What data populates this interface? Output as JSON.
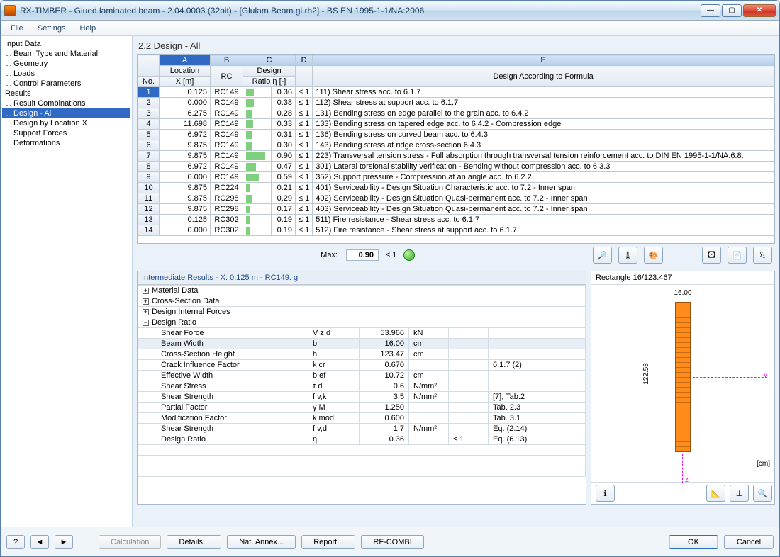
{
  "window": {
    "title": "RX-TIMBER - Glued laminated beam - 2.04.0003 (32bit) - [Glulam Beam.gl.rh2] - BS EN 1995-1-1/NA:2006"
  },
  "menu": {
    "file": "File",
    "settings": "Settings",
    "help": "Help"
  },
  "tree": {
    "input": "Input Data",
    "beamtype": "Beam Type and Material",
    "geometry": "Geometry",
    "loads": "Loads",
    "control": "Control Parameters",
    "results": "Results",
    "rescomb": "Result Combinations",
    "designall": "Design - All",
    "designloc": "Design by Location X",
    "support": "Support Forces",
    "deform": "Deformations"
  },
  "main": {
    "title": "2.2 Design - All",
    "colA": "A",
    "colB": "B",
    "colC": "C",
    "colD": "D",
    "colE": "E",
    "hNo": "No.",
    "hLoc": "Location",
    "hX": "X [m]",
    "hRC": "RC",
    "hDesign": "Design",
    "hRatio": "Ratio η [-]",
    "hFormula": "Design According to Formula",
    "rows": [
      {
        "no": "1",
        "x": "0.125",
        "rc": "RC149",
        "bar": 36,
        "ratio": "0.36",
        "le": "≤ 1",
        "formula": "111) Shear stress acc. to 6.1.7"
      },
      {
        "no": "2",
        "x": "0.000",
        "rc": "RC149",
        "bar": 38,
        "ratio": "0.38",
        "le": "≤ 1",
        "formula": "112) Shear stress at support acc. to 6.1.7"
      },
      {
        "no": "3",
        "x": "6.275",
        "rc": "RC149",
        "bar": 28,
        "ratio": "0.28",
        "le": "≤ 1",
        "formula": "131) Bending stress on edge parallel to the grain acc. to 6.4.2"
      },
      {
        "no": "4",
        "x": "11.698",
        "rc": "RC149",
        "bar": 33,
        "ratio": "0.33",
        "le": "≤ 1",
        "formula": "133) Bending stress on tapered edge acc. to 6.4.2 - Compression edge"
      },
      {
        "no": "5",
        "x": "6.972",
        "rc": "RC149",
        "bar": 31,
        "ratio": "0.31",
        "le": "≤ 1",
        "formula": "136) Bending stress on curved beam acc. to 6.4.3"
      },
      {
        "no": "6",
        "x": "9.875",
        "rc": "RC149",
        "bar": 30,
        "ratio": "0.30",
        "le": "≤ 1",
        "formula": "143) Bending stress at ridge cross-section 6.4.3"
      },
      {
        "no": "7",
        "x": "9.875",
        "rc": "RC149",
        "bar": 90,
        "ratio": "0.90",
        "le": "≤ 1",
        "formula": "223) Transversal tension stress - Full absorption through transversal tension reinforcement acc. to DIN EN 1995-1-1/NA.6.8."
      },
      {
        "no": "8",
        "x": "6.972",
        "rc": "RC149",
        "bar": 47,
        "ratio": "0.47",
        "le": "≤ 1",
        "formula": "301) Lateral torsional stability verification - Bending without compression acc. to 6.3.3"
      },
      {
        "no": "9",
        "x": "0.000",
        "rc": "RC149",
        "bar": 59,
        "ratio": "0.59",
        "le": "≤ 1",
        "formula": "352) Support pressure - Compression at an angle acc. to 6.2.2"
      },
      {
        "no": "10",
        "x": "9.875",
        "rc": "RC224",
        "bar": 21,
        "ratio": "0.21",
        "le": "≤ 1",
        "formula": "401) Serviceability - Design Situation Characteristic acc. to 7.2 - Inner span"
      },
      {
        "no": "11",
        "x": "9.875",
        "rc": "RC298",
        "bar": 29,
        "ratio": "0.29",
        "le": "≤ 1",
        "formula": "402) Serviceability - Design Situation Quasi-permanent acc. to 7.2 - Inner span"
      },
      {
        "no": "12",
        "x": "9.875",
        "rc": "RC298",
        "bar": 17,
        "ratio": "0.17",
        "le": "≤ 1",
        "formula": "403) Serviceability - Design Situation Quasi-permanent acc. to 7.2 - Inner span"
      },
      {
        "no": "13",
        "x": "0.125",
        "rc": "RC302",
        "bar": 19,
        "ratio": "0.19",
        "le": "≤ 1",
        "formula": "511) Fire resistance - Shear stress acc. to 6.1.7"
      },
      {
        "no": "14",
        "x": "0.000",
        "rc": "RC302",
        "bar": 19,
        "ratio": "0.19",
        "le": "≤ 1",
        "formula": "512) Fire resistance - Shear stress at support acc. to 6.1.7"
      }
    ],
    "maxlbl": "Max:",
    "maxval": "0.90",
    "maxle": "≤ 1"
  },
  "inter": {
    "title": "Intermediate Results  -  X: 0.125 m  -  RC149: g",
    "g1": "Material Data",
    "g2": "Cross-Section Data",
    "g3": "Design Internal Forces",
    "g4": "Design Ratio",
    "rows": [
      {
        "n": "Shear Force",
        "s": "V z,d",
        "v": "53.966",
        "u": "kN",
        "c": "",
        "r": ""
      },
      {
        "n": "Beam Width",
        "s": "b",
        "v": "16.00",
        "u": "cm",
        "c": "",
        "r": "",
        "hl": true
      },
      {
        "n": "Cross-Section Height",
        "s": "h",
        "v": "123.47",
        "u": "cm",
        "c": "",
        "r": ""
      },
      {
        "n": "Crack Influence Factor",
        "s": "k cr",
        "v": "0.670",
        "u": "",
        "c": "",
        "r": "6.1.7 (2)"
      },
      {
        "n": "Effective Width",
        "s": "b ef",
        "v": "10.72",
        "u": "cm",
        "c": "",
        "r": ""
      },
      {
        "n": "Shear Stress",
        "s": "τ d",
        "v": "0.6",
        "u": "N/mm²",
        "c": "",
        "r": ""
      },
      {
        "n": "Shear Strength",
        "s": "f v,k",
        "v": "3.5",
        "u": "N/mm²",
        "c": "",
        "r": "[7], Tab.2"
      },
      {
        "n": "Partial Factor",
        "s": "γ M",
        "v": "1.250",
        "u": "",
        "c": "",
        "r": "Tab. 2.3"
      },
      {
        "n": "Modification Factor",
        "s": "k mod",
        "v": "0.600",
        "u": "",
        "c": "",
        "r": "Tab. 3.1"
      },
      {
        "n": "Shear Strength",
        "s": "f v,d",
        "v": "1.7",
        "u": "N/mm²",
        "c": "",
        "r": "Eq. (2.14)"
      },
      {
        "n": "Design Ratio",
        "s": "η",
        "v": "0.36",
        "u": "",
        "c": "≤ 1",
        "r": "Eq. (6.13)"
      }
    ]
  },
  "cs": {
    "name": "Rectangle 16/123.467",
    "w": "16.00",
    "h": "122.58",
    "y": "y",
    "z": "z",
    "unit": "[cm]"
  },
  "footer": {
    "calc": "Calculation",
    "details": "Details...",
    "nat": "Nat. Annex...",
    "report": "Report...",
    "rfcombi": "RF-COMBI",
    "ok": "OK",
    "cancel": "Cancel"
  }
}
